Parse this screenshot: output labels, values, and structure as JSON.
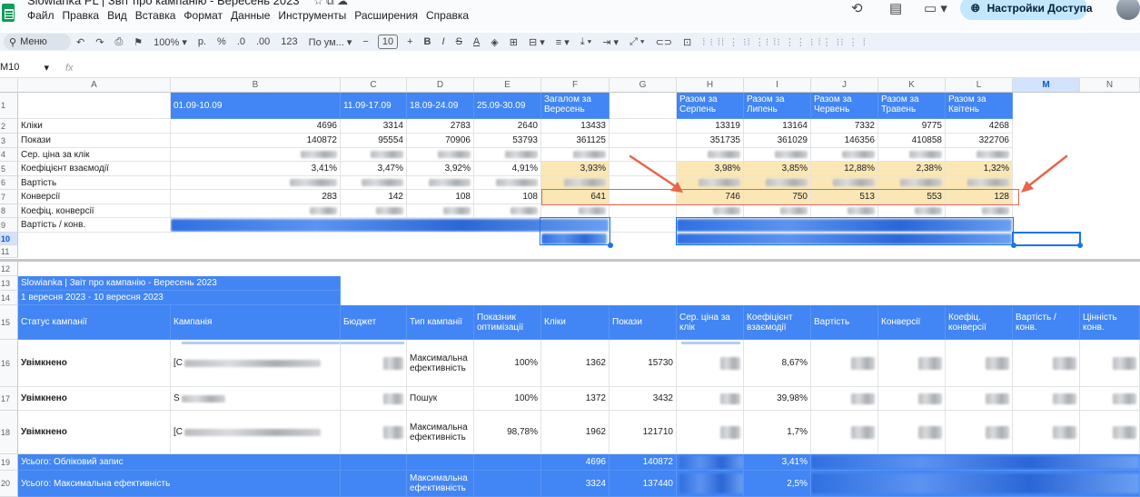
{
  "app": {
    "title": "Slowianka PL | Звіт про кампанію - Вересень 2023",
    "menu": [
      "Файл",
      "Правка",
      "Вид",
      "Вставка",
      "Формат",
      "Данные",
      "Инструменты",
      "Расширения",
      "Справка"
    ],
    "share_label": "Настройки Доступа"
  },
  "toolbar": {
    "search_label": "Меню",
    "zoom": "100%",
    "currency": "р.",
    "percent": "%",
    "dec_less": ".0",
    "dec_more": ".00",
    "num_format": "123",
    "font": "По ум...",
    "font_size": "10",
    "bold": "B",
    "italic": "I",
    "strike": "S",
    "text_color": "A"
  },
  "formula_bar": {
    "cell_ref": "M10",
    "fx": "fx"
  },
  "columns": [
    "A",
    "B",
    "C",
    "D",
    "E",
    "F",
    "G",
    "H",
    "I",
    "J",
    "K",
    "L",
    "M",
    "N"
  ],
  "rows": [
    "1",
    "2",
    "3",
    "4",
    "5",
    "6",
    "7",
    "8",
    "9",
    "10",
    "11",
    "12",
    "13",
    "14",
    "15",
    "16",
    "17",
    "18",
    "19",
    "20"
  ],
  "top_table": {
    "headers": {
      "b": "01.09-10.09",
      "c": "11.09-17.09",
      "d": "18.09-24.09",
      "e": "25.09-30.09",
      "f": "Загалом за Вересень",
      "h": "Разом за Серпень",
      "i": "Разом за Липень",
      "j": "Разом за Червень",
      "k": "Разом за Травень",
      "l": "Разом за Квітень"
    },
    "labels": [
      "Кліки",
      "Покази",
      "Сер. ціна за клік",
      "Коефіцієнт взаємодії",
      "Вартість",
      "Конверсії",
      "Коефіц. конверсії",
      "Вартість / конв."
    ],
    "clicks": [
      "4696",
      "3314",
      "2783",
      "2640",
      "13433",
      "13319",
      "13164",
      "7332",
      "9775",
      "4268"
    ],
    "impressions": [
      "140872",
      "95554",
      "70906",
      "53793",
      "361125",
      "351735",
      "361029",
      "146356",
      "410858",
      "322706"
    ],
    "ctr": [
      "3,41%",
      "3,47%",
      "3,92%",
      "4,91%",
      "3,93%",
      "3,98%",
      "3,85%",
      "12,88%",
      "2,38%",
      "1,32%"
    ],
    "conversions": [
      "283",
      "142",
      "108",
      "108",
      "641",
      "746",
      "750",
      "513",
      "553",
      "128"
    ]
  },
  "bottom_table": {
    "title": "Slowianka | Звіт про кампанію - Вересень 2023",
    "date_range": "1 вересня 2023 - 10 вересня 2023",
    "headers": [
      "Статус кампанії",
      "Кампанія",
      "Бюджет",
      "Тип кампанії",
      "Показник оптимізації",
      "Кліки",
      "Покази",
      "Сер. ціна за клік",
      "Коефіцієнт взаємодії",
      "Вартість",
      "Конверсії",
      "Коефіц. конверсії",
      "Вартість / конв.",
      "Цінність конв."
    ],
    "rows": [
      {
        "status": "Увімкнено",
        "campaign": "[C",
        "type": "Максимальна ефективність",
        "optimization": "100%",
        "clicks": "1362",
        "impressions": "15730",
        "ctr": "8,67%"
      },
      {
        "status": "Увімкнено",
        "campaign": "S",
        "type": "Пошук",
        "optimization": "100%",
        "clicks": "1372",
        "impressions": "3432",
        "ctr": "39,98%"
      },
      {
        "status": "Увімкнено",
        "campaign": "[C",
        "type": "Максимальна ефективність",
        "optimization": "98,78%",
        "clicks": "1962",
        "impressions": "121710",
        "ctr": "1,7%"
      }
    ],
    "totals": [
      {
        "label": "Усього: Обліковий запис",
        "type": "",
        "clicks": "4696",
        "impressions": "140872",
        "ctr": "3,41%"
      },
      {
        "label": "Усього: Максимальна ефективність",
        "type": "Максимальна ефективність",
        "clicks": "3324",
        "impressions": "137440",
        "ctr": "2,5%"
      }
    ]
  },
  "colors": {
    "header_blue": "#4285f4",
    "highlight_yellow": "#fbe7b6",
    "annotation_orange": "#e8654a",
    "selection_blue": "#1a73e8"
  }
}
